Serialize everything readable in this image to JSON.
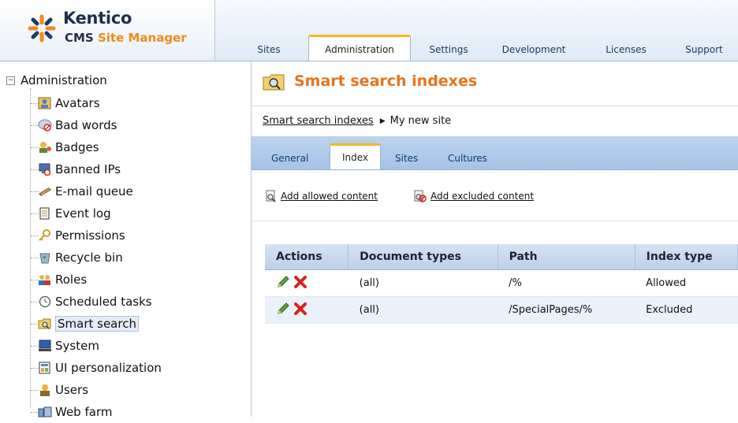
{
  "app": {
    "brand": "Kentico",
    "subtitle_prefix": "CMS",
    "subtitle_accent": "Site Manager",
    "accent_color": "#f08a1c"
  },
  "main_tabs": [
    {
      "label": "Sites",
      "active": false
    },
    {
      "label": "Administration",
      "active": true
    },
    {
      "label": "Settings",
      "active": false
    },
    {
      "label": "Development",
      "active": false
    },
    {
      "label": "Licenses",
      "active": false
    },
    {
      "label": "Support",
      "active": false
    }
  ],
  "tree": {
    "root": {
      "label": "Administration",
      "toggle": "−"
    },
    "items": [
      {
        "label": "Avatars",
        "icon": "avatar-icon"
      },
      {
        "label": "Bad words",
        "icon": "bad-words-icon"
      },
      {
        "label": "Badges",
        "icon": "badges-icon"
      },
      {
        "label": "Banned IPs",
        "icon": "banned-ips-icon"
      },
      {
        "label": "E-mail queue",
        "icon": "email-queue-icon"
      },
      {
        "label": "Event log",
        "icon": "event-log-icon"
      },
      {
        "label": "Permissions",
        "icon": "permissions-icon"
      },
      {
        "label": "Recycle bin",
        "icon": "recycle-bin-icon"
      },
      {
        "label": "Roles",
        "icon": "roles-icon"
      },
      {
        "label": "Scheduled tasks",
        "icon": "clock-icon"
      },
      {
        "label": "Smart search",
        "icon": "folder-search-icon",
        "selected": true
      },
      {
        "label": "System",
        "icon": "computer-icon"
      },
      {
        "label": "UI personalization",
        "icon": "ui-personalization-icon"
      },
      {
        "label": "Users",
        "icon": "user-icon"
      },
      {
        "label": "Web farm",
        "icon": "web-farm-icon"
      }
    ]
  },
  "page": {
    "title": "Smart search indexes",
    "breadcrumb": {
      "link": "Smart search indexes",
      "separator": "▶",
      "current": "My new site"
    }
  },
  "sub_tabs": [
    {
      "label": "General",
      "active": false
    },
    {
      "label": "Index",
      "active": true
    },
    {
      "label": "Sites",
      "active": false
    },
    {
      "label": "Cultures",
      "active": false
    }
  ],
  "actions": {
    "add_allowed": "Add allowed content",
    "add_excluded": "Add excluded content"
  },
  "grid": {
    "headers": [
      "Actions",
      "Document types",
      "Path",
      "Index type"
    ],
    "rows": [
      {
        "document_types": "(all)",
        "path": "/%",
        "index_type": "Allowed"
      },
      {
        "document_types": "(all)",
        "path": "/SpecialPages/%",
        "index_type": "Excluded"
      }
    ]
  }
}
